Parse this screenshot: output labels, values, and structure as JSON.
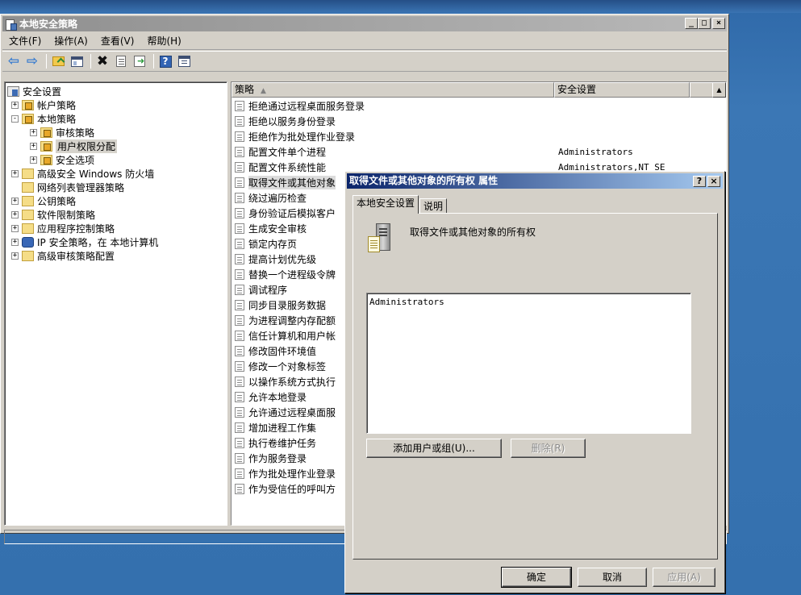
{
  "main_window": {
    "title": "本地安全策略",
    "title_buttons": [
      "_",
      "□",
      "×"
    ]
  },
  "menu": [
    "文件(F)",
    "操作(A)",
    "查看(V)",
    "帮助(H)"
  ],
  "toolbar": {
    "icons": [
      "back-icon",
      "forward-icon",
      "up-folder-icon",
      "show-hide-tree-icon",
      "delete-icon",
      "properties-icon",
      "export-list-icon",
      "help-icon",
      "console-icon"
    ]
  },
  "tree": {
    "items": [
      {
        "label": "安全设置",
        "icon": "root",
        "expander": ""
      },
      {
        "label": "帐户策略",
        "icon": "folder-lock",
        "expander": "+"
      },
      {
        "label": "本地策略",
        "icon": "folder-lock",
        "expander": "-"
      },
      {
        "label": "审核策略",
        "icon": "folder-lock",
        "expander": "+"
      },
      {
        "label": "用户权限分配",
        "icon": "folder-lock",
        "expander": "+",
        "selected": true
      },
      {
        "label": "安全选项",
        "icon": "folder-lock",
        "expander": "+"
      },
      {
        "label": "高级安全 Windows 防火墙",
        "icon": "folder",
        "expander": "+"
      },
      {
        "label": "网络列表管理器策略",
        "icon": "folder",
        "expander": ""
      },
      {
        "label": "公钥策略",
        "icon": "folder",
        "expander": "+"
      },
      {
        "label": "软件限制策略",
        "icon": "folder",
        "expander": "+"
      },
      {
        "label": "应用程序控制策略",
        "icon": "folder",
        "expander": "+"
      },
      {
        "label": "IP 安全策略，在 本地计算机",
        "icon": "net",
        "expander": "+"
      },
      {
        "label": "高级审核策略配置",
        "icon": "folder",
        "expander": "+"
      }
    ]
  },
  "list": {
    "columns": [
      "策略",
      "安全设置"
    ],
    "rows": [
      {
        "policy": "拒绝通过远程桌面服务登录",
        "setting": ""
      },
      {
        "policy": "拒绝以服务身份登录",
        "setting": ""
      },
      {
        "policy": "拒绝作为批处理作业登录",
        "setting": ""
      },
      {
        "policy": "配置文件单个进程",
        "setting": "Administrators"
      },
      {
        "policy": "配置文件系统性能",
        "setting": "Administrators,NT SE"
      },
      {
        "policy": "取得文件或其他对象",
        "setting": "",
        "selected": true
      },
      {
        "policy": "绕过遍历检查",
        "setting": ""
      },
      {
        "policy": "身份验证后模拟客户",
        "setting": ""
      },
      {
        "policy": "生成安全审核",
        "setting": ""
      },
      {
        "policy": "锁定内存页",
        "setting": ""
      },
      {
        "policy": "提高计划优先级",
        "setting": ""
      },
      {
        "policy": "替换一个进程级令牌",
        "setting": ""
      },
      {
        "policy": "调试程序",
        "setting": ""
      },
      {
        "policy": "同步目录服务数据",
        "setting": ""
      },
      {
        "policy": "为进程调整内存配额",
        "setting": ""
      },
      {
        "policy": "信任计算机和用户帐",
        "setting": ""
      },
      {
        "policy": "修改固件环境值",
        "setting": ""
      },
      {
        "policy": "修改一个对象标签",
        "setting": ""
      },
      {
        "policy": "以操作系统方式执行",
        "setting": ""
      },
      {
        "policy": "允许本地登录",
        "setting": ""
      },
      {
        "policy": "允许通过远程桌面服",
        "setting": ""
      },
      {
        "policy": "增加进程工作集",
        "setting": ""
      },
      {
        "policy": "执行卷维护任务",
        "setting": ""
      },
      {
        "policy": "作为服务登录",
        "setting": ""
      },
      {
        "policy": "作为批处理作业登录",
        "setting": ""
      },
      {
        "policy": "作为受信任的呼叫方",
        "setting": ""
      }
    ]
  },
  "dialog": {
    "title": "取得文件或其他对象的所有权 属性",
    "title_buttons": [
      "?",
      "×"
    ],
    "tabs": [
      "本地安全设置",
      "说明"
    ],
    "policy_name": "取得文件或其他对象的所有权",
    "members": [
      "Administrators"
    ],
    "add_button": "添加用户或组(U)...",
    "remove_button": "删除(R)",
    "ok_button": "确定",
    "cancel_button": "取消",
    "apply_button": "应用(A)"
  }
}
